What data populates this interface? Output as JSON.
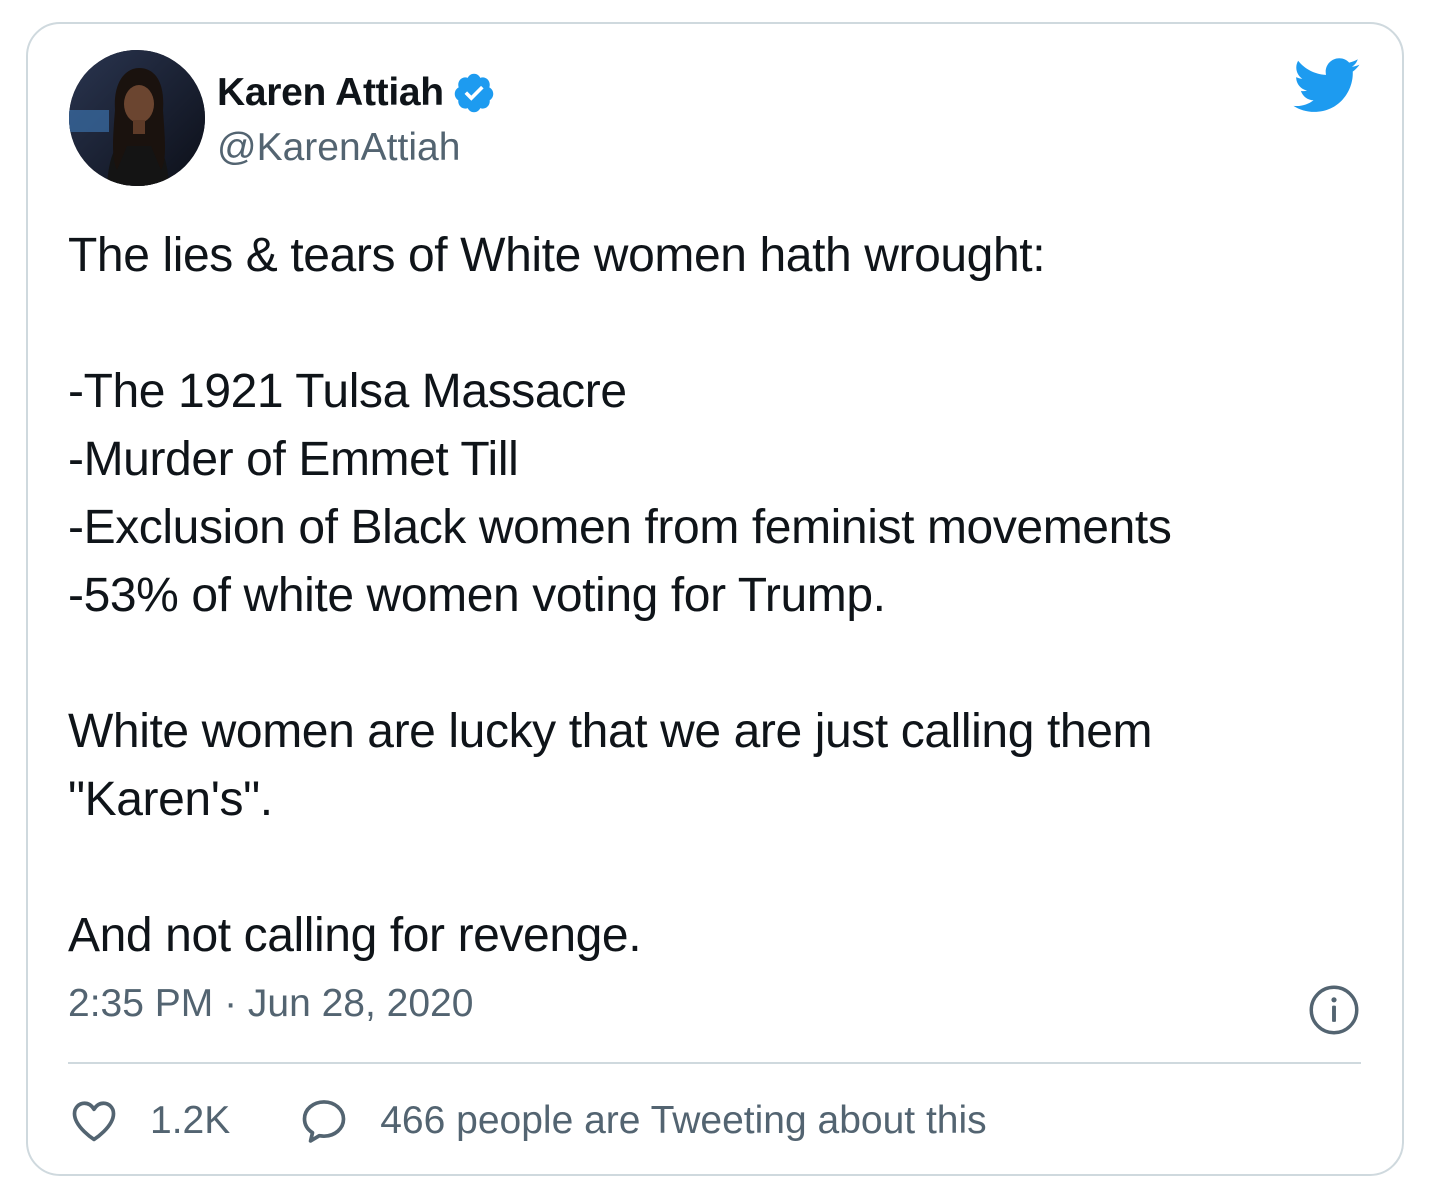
{
  "tweet": {
    "author": {
      "display_name": "Karen Attiah",
      "handle": "@KarenAttiah",
      "verified": true,
      "avatar_icon": "profile-photo"
    },
    "text_lines": [
      "The lies & tears of White women hath wrought:",
      "",
      "-The 1921 Tulsa Massacre",
      "-Murder of Emmet Till",
      "-Exclusion of Black women from feminist movements",
      "-53% of white women voting for Trump.",
      "",
      "White women are lucky that we are just calling them",
      "\"Karen's\".",
      "",
      "And not calling for revenge."
    ],
    "timestamp": "2:35 PM · Jun 28, 2020",
    "likes": "1.2K",
    "replies_text": "466 people are Tweeting about this"
  },
  "icons": {
    "brand": "twitter-bird-icon",
    "verified": "verified-badge-icon",
    "info": "info-icon",
    "like": "heart-icon",
    "reply": "speech-bubble-icon"
  },
  "colors": {
    "brand_blue": "#1d9bf0",
    "text_primary": "#0f1419",
    "text_secondary": "#536471",
    "border": "#cfd9de"
  }
}
